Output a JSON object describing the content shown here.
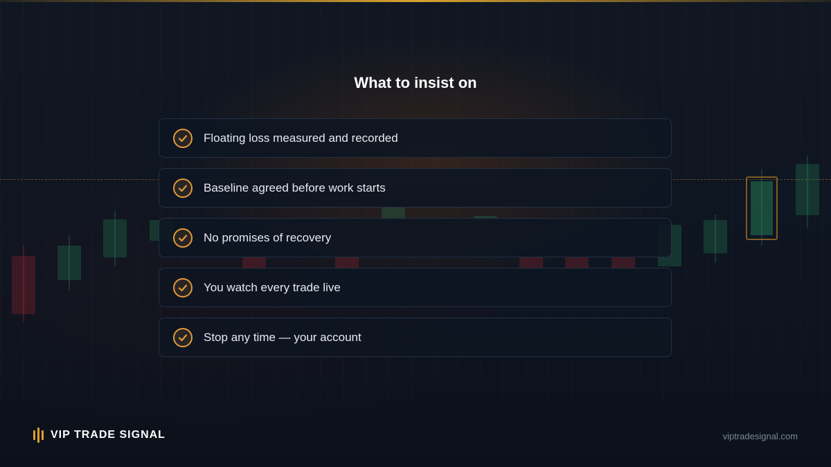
{
  "slide": {
    "title": "What to insist on"
  },
  "checklist": {
    "items": [
      {
        "label": "Floating loss measured and recorded"
      },
      {
        "label": "Baseline agreed before work starts"
      },
      {
        "label": "No promises of recovery"
      },
      {
        "label": "You watch every trade live"
      },
      {
        "label": "Stop any time — your account"
      }
    ]
  },
  "footer": {
    "brand": "VIP TRADE SIGNAL",
    "url": "viptradesignal.com"
  },
  "colors": {
    "accent": "#e39a3b",
    "background": "#0d1420",
    "card": "#0e1622"
  },
  "icons": {
    "item_icon": "check-circle-icon",
    "logo_icon": "signal-bars-icon"
  }
}
